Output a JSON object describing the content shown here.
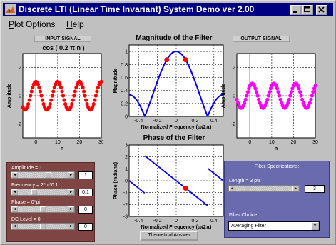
{
  "window": {
    "title": "Discrete LTI (Linear Time Invariant) System Demo ver 2.00",
    "controls": [
      "minimize-icon",
      "maximize-icon",
      "close-icon"
    ]
  },
  "menu": {
    "items": [
      {
        "label": "Plot Options",
        "ul": "P"
      },
      {
        "label": "Help",
        "ul": "H"
      }
    ]
  },
  "input_plot": {
    "header": "INPUT SIGNAL",
    "title": "cos ( 0.2 π n )"
  },
  "mag_plot": {
    "title": "Magnitude of the Filter"
  },
  "phase_plot": {
    "title": "Phase of the Filter"
  },
  "output_plot": {
    "header": "OUTPUT SIGNAL"
  },
  "input_controls": {
    "amplitude_label": "Amplitude = 1",
    "amplitude_value": "1",
    "frequency_label": "Frequency = 2*pi*0.1",
    "frequency_value": "0.1",
    "phase_label": "Phase = 0*pi",
    "phase_value": "0",
    "dc_label": "DC Level = 0",
    "dc_value": "0"
  },
  "filter_specs": {
    "header": "Filter Specifications:",
    "length_label": "Length = 3 pts",
    "length_value": "3",
    "choice_label": "Filter Choice:",
    "choice_value": "Averaging Filter"
  },
  "theoretical_button": "Theoretical Answer",
  "colors": {
    "input_signal": "#ff0000",
    "output_signal": "#ff00ff",
    "filter_curve": "#0000ff",
    "marker": "#ff0000",
    "cursor_line": "#8b0000",
    "input_panel": "#7f4545",
    "filter_panel": "#6a6aaf"
  },
  "chart_data": [
    {
      "name": "input-signal",
      "type": "scatter",
      "xlabel": "n",
      "ylabel": "Amplitude",
      "xlim": [
        -6,
        30
      ],
      "ylim": [
        -3,
        3
      ],
      "xticks": [
        0,
        10,
        20,
        30
      ],
      "yticks": [
        -2,
        0,
        2
      ],
      "grid": true,
      "series": [
        {
          "x_start": -6,
          "x_end": 30,
          "amplitude": 1,
          "freq": 0.1,
          "dc": 0
        }
      ],
      "vline_x": 0
    },
    {
      "name": "magnitude",
      "type": "line",
      "xlabel": "Normalized Frequency (ω/2π)",
      "ylabel": "Magnitude",
      "xlim": [
        -0.5,
        0.5
      ],
      "ylim": [
        0,
        1.1
      ],
      "xticks": [
        -0.4,
        -0.2,
        0,
        0.2,
        0.4
      ],
      "yticks": [
        0,
        0.2,
        0.4,
        0.6,
        0.8,
        1
      ],
      "grid": true,
      "markers": [
        {
          "x": -0.1,
          "y": 0.873
        },
        {
          "x": 0.1,
          "y": 0.873
        }
      ]
    },
    {
      "name": "phase",
      "type": "line",
      "xlabel": "Normalized Frequency (ω/2π)",
      "ylabel": "Phase (radians)",
      "xlim": [
        -0.5,
        0.5
      ],
      "ylim": [
        -3,
        3
      ],
      "xticks": [
        -0.4,
        -0.2,
        0,
        0.2,
        0.4
      ],
      "yticks": [
        -3,
        -2,
        -1,
        0,
        1,
        2,
        3
      ],
      "grid": true,
      "markers": [
        {
          "x": 0.1,
          "y": -0.628
        }
      ]
    },
    {
      "name": "output-signal",
      "type": "scatter",
      "xlabel": "n",
      "ylabel": "Amplitude",
      "xlim": [
        -6,
        30
      ],
      "ylim": [
        -3,
        3
      ],
      "xticks": [
        0,
        10,
        20,
        30
      ],
      "yticks": [
        -2,
        0,
        2
      ],
      "grid": true,
      "series": [
        {
          "x_start": -6,
          "x_end": 30,
          "amplitude": 0.873,
          "freq": 0.1,
          "phase": -0.628
        }
      ],
      "vline_x": 0
    }
  ]
}
